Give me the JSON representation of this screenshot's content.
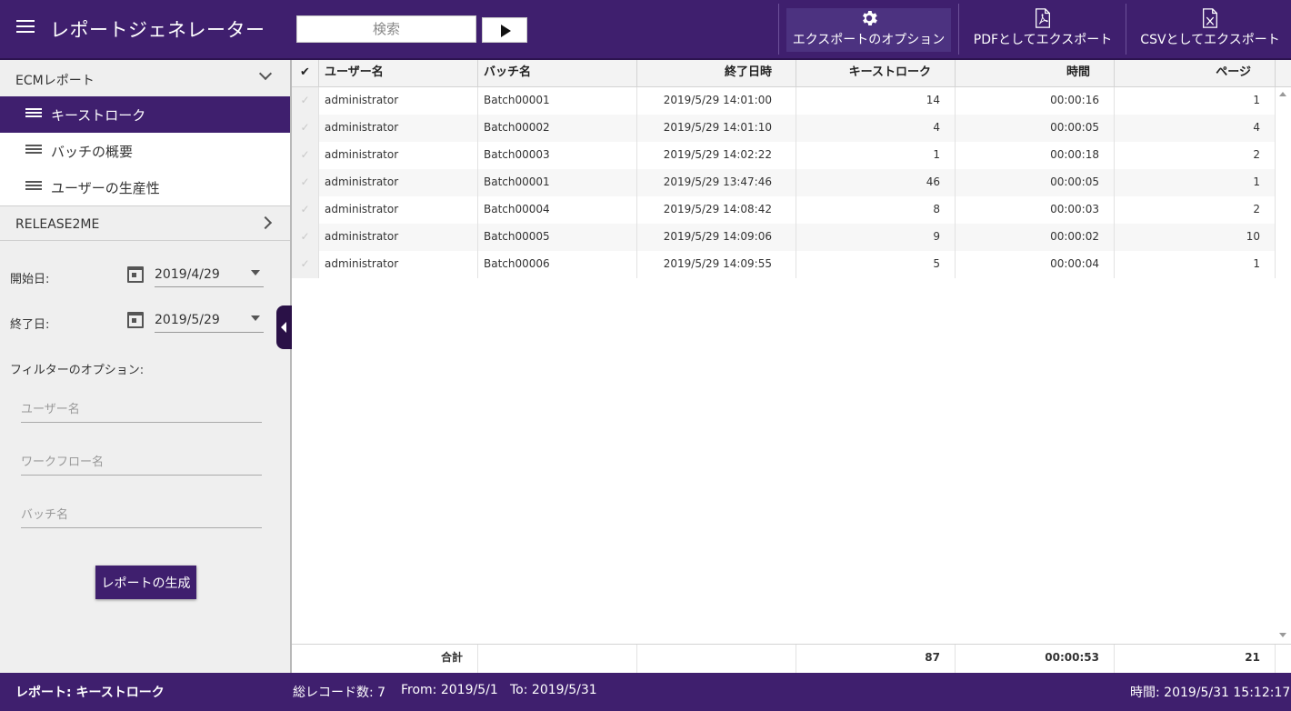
{
  "header": {
    "title": "レポートジェネレーター",
    "search_placeholder": "検索",
    "export_options": "エクスポートのオプション",
    "export_pdf": "PDFとしてエクスポート",
    "export_csv": "CSVとしてエクスポート"
  },
  "sidebar": {
    "group1": "ECMレポート",
    "items": [
      {
        "label": "キーストローク"
      },
      {
        "label": "バッチの概要"
      },
      {
        "label": "ユーザーの生産性"
      }
    ],
    "group2": "RELEASE2ME",
    "start_label": "開始日:",
    "start_value": "2019/4/29",
    "end_label": "終了日:",
    "end_value": "2019/5/29",
    "filter_label": "フィルターのオプション:",
    "user_placeholder": "ユーザー名",
    "workflow_placeholder": "ワークフロー名",
    "batch_placeholder": "バッチ名",
    "generate_button": "レポートの生成"
  },
  "grid": {
    "check_header": "✔",
    "columns": [
      "ユーザー名",
      "バッチ名",
      "終了日時",
      "キーストローク",
      "時間",
      "ページ"
    ],
    "rows": [
      [
        "administrator",
        "Batch00001",
        "2019/5/29 14:01:00",
        "14",
        "00:00:16",
        "1"
      ],
      [
        "administrator",
        "Batch00002",
        "2019/5/29 14:01:10",
        "4",
        "00:00:05",
        "4"
      ],
      [
        "administrator",
        "Batch00003",
        "2019/5/29 14:02:22",
        "1",
        "00:00:18",
        "2"
      ],
      [
        "administrator",
        "Batch00001",
        "2019/5/29 13:47:46",
        "46",
        "00:00:05",
        "1"
      ],
      [
        "administrator",
        "Batch00004",
        "2019/5/29 14:08:42",
        "8",
        "00:00:03",
        "2"
      ],
      [
        "administrator",
        "Batch00005",
        "2019/5/29 14:09:06",
        "9",
        "00:00:02",
        "10"
      ],
      [
        "administrator",
        "Batch00006",
        "2019/5/29 14:09:55",
        "5",
        "00:00:04",
        "1"
      ]
    ],
    "row_check": "✓",
    "footer": {
      "label": "合計",
      "keystrokes": "87",
      "time": "00:00:53",
      "pages": "21"
    }
  },
  "status": {
    "report": "レポート: キーストローク",
    "records": "総レコード数: 7",
    "from": "From: 2019/5/1",
    "to": "To: 2019/5/31",
    "time": "時間: 2019/5/31 15:12:17"
  }
}
